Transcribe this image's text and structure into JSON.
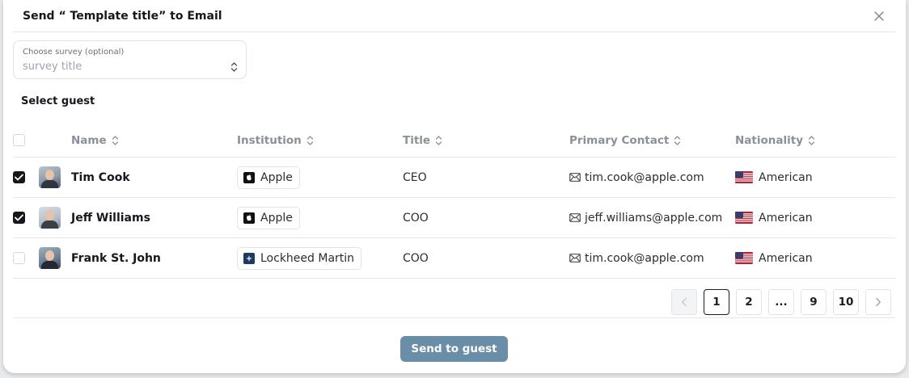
{
  "modal": {
    "title": "Send “ Template title” to Email",
    "close_icon": "close-icon"
  },
  "survey": {
    "label": "Choose survey (optional)",
    "value": "survey title",
    "icon": "sort-icon"
  },
  "guests": {
    "section_title": "Select guest",
    "columns": {
      "name": "Name",
      "institution": "Institution",
      "title": "Title",
      "contact": "Primary Contact",
      "nationality": "Nationality"
    },
    "rows": [
      {
        "checked": true,
        "name": "Tim Cook",
        "institution": "Apple",
        "institution_logo": "apple-logo",
        "title": "CEO",
        "contact": "tim.cook@apple.com",
        "nationality": "American",
        "flag": "us-flag"
      },
      {
        "checked": true,
        "name": "Jeff Williams",
        "institution": "Apple",
        "institution_logo": "apple-logo",
        "title": "COO",
        "contact": "jeff.williams@apple.com",
        "nationality": "American",
        "flag": "us-flag"
      },
      {
        "checked": false,
        "name": "Frank St. John",
        "institution": "Lockheed Martin",
        "institution_logo": "lockheed-martin-logo",
        "title": "COO",
        "contact": "tim.cook@apple.com",
        "nationality": "American",
        "flag": "us-flag"
      }
    ]
  },
  "pagination": {
    "pages": [
      "1",
      "2",
      "...",
      "9",
      "10"
    ],
    "current": "1"
  },
  "footer": {
    "send_label": "Send to guest"
  },
  "colors": {
    "primary_button": "#6b8ea8",
    "checkbox_checked": "#15171b",
    "border": "#e6e7ea"
  }
}
